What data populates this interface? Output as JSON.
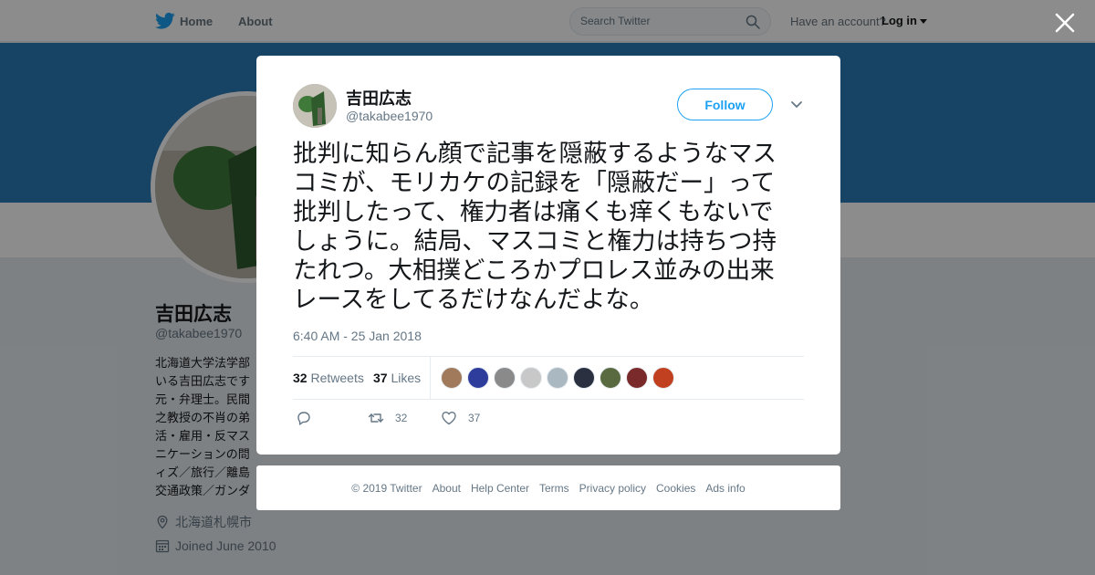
{
  "nav": {
    "home_label": "Home",
    "about_label": "About",
    "search_placeholder": "Search Twitter",
    "account_prompt": "Have an account?",
    "login_label": "Log in"
  },
  "profile": {
    "name": "吉田広志",
    "handle": "@takabee1970",
    "bio_lines": [
      "北海道大学法学部",
      "いる吉田広志です",
      "元・弁理士。民間",
      "之教授の不肖の弟",
      "活・雇用・反マス",
      "ニケーションの問",
      "ィズ／旅行／離島",
      "交通政策／ガンダ"
    ],
    "location": "北海道札幌市",
    "joined": "Joined June 2010"
  },
  "tweet": {
    "author_name": "吉田広志",
    "author_handle": "@takabee1970",
    "follow_label": "Follow",
    "text_lines": [
      "批判に知らん顔で記事を隠蔽するようなマス",
      "コミが、モリカケの記録を「隠蔽だー」って",
      "批判したって、権力者は痛くも痒くもないで",
      "しょうに。結局、マスコミと権力は持ちつ持",
      "たれつ。大相撲どころかプロレス並みの出来",
      "レースをしてるだけなんだよな。"
    ],
    "timestamp": "6:40 AM - 25 Jan 2018",
    "retweet_count": "32",
    "retweets_label": "Retweets",
    "like_count": "37",
    "likes_label": "Likes",
    "action_retweet_count": "32",
    "action_like_count": "37",
    "liker_colors": [
      "#a07a5a",
      "#2e3d9c",
      "#8a8a8a",
      "#c8c8c8",
      "#aab8c2",
      "#2a3040",
      "#5a6a40",
      "#7a2a2a",
      "#c04020"
    ]
  },
  "footer": {
    "copyright": "© 2019 Twitter",
    "links": [
      "About",
      "Help Center",
      "Terms",
      "Privacy policy",
      "Cookies",
      "Ads info"
    ]
  },
  "colors": {
    "brand": "#1da1f2",
    "banner": "#2b7bb9"
  }
}
